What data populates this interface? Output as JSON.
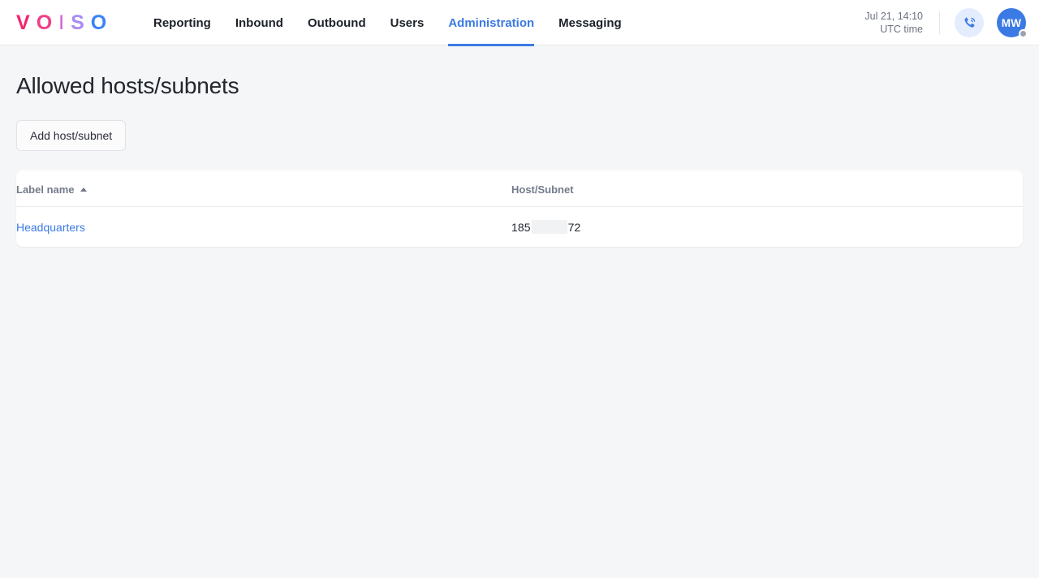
{
  "brand": {
    "letters": [
      "V",
      "O",
      "I",
      "S",
      "O"
    ],
    "colors": [
      "#f4246e",
      "#ef3f86",
      "#d05ed2",
      "#a98cf0",
      "#3b82f6"
    ]
  },
  "nav": {
    "items": [
      {
        "label": "Reporting",
        "active": false
      },
      {
        "label": "Inbound",
        "active": false
      },
      {
        "label": "Outbound",
        "active": false
      },
      {
        "label": "Users",
        "active": false
      },
      {
        "label": "Administration",
        "active": true
      },
      {
        "label": "Messaging",
        "active": false
      }
    ],
    "active_color": "#3b7ae4"
  },
  "header_right": {
    "datetime": "Jul 21, 14:10",
    "timezone_label": "UTC time",
    "phone_icon": "phone-ringing-icon",
    "avatar_initials": "MW",
    "avatar_color": "#3b7ae4",
    "status_dot_color": "#9ca3af"
  },
  "page": {
    "title": "Allowed hosts/subnets",
    "add_button_label": "Add host/subnet"
  },
  "table": {
    "columns": [
      {
        "key": "label_name",
        "label": "Label name",
        "sorted": "asc",
        "sort_icon": "caret-up-icon"
      },
      {
        "key": "host_subnet",
        "label": "Host/Subnet",
        "sorted": "none"
      }
    ],
    "rows": [
      {
        "label_name": "Headquarters",
        "host_prefix": "185",
        "host_redacted": true,
        "host_suffix": "72"
      }
    ]
  }
}
